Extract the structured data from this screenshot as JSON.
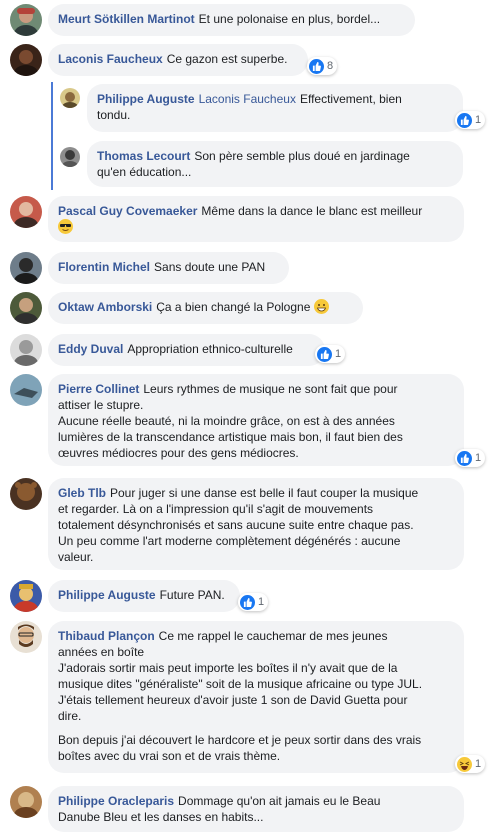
{
  "comments": [
    {
      "name": "Meurt Sötkillen Martinot",
      "text": "Et une polonaise en plus, bordel..."
    },
    {
      "name": "Laconis Faucheux",
      "text": "Ce gazon est superbe.",
      "reactions": "8"
    },
    {
      "name": "Philippe Auguste",
      "tag": "Laconis Faucheux",
      "text": "Effectivement, bien\ntondu.",
      "reactions": "1"
    },
    {
      "name": "Thomas Lecourt",
      "text": "Son père semble plus doué en jardinage\nqu'en éducation..."
    },
    {
      "name": "Pascal Guy Covemaeker",
      "text": "Même dans la dance le blanc est meilleur",
      "emoji": "sunglasses-emoji"
    },
    {
      "name": "Florentin Michel",
      "text": "Sans doute une PAN"
    },
    {
      "name": "Oktaw Amborski",
      "text": "Ça a bien changé la Pologne",
      "emoji": "grin-emoji"
    },
    {
      "name": "Eddy Duval",
      "text": "Appropriation ethnico-culturelle",
      "reactions": "1"
    },
    {
      "name": "Pierre Collinet",
      "text": "Leurs rythmes de musique ne sont fait que pour\nattiser le stupre.\nAucune réelle beauté, ni la moindre grâce, on est à des années\nlumières de la transcendance artistique mais bon, il faut bien des\nœuvres médiocres pour des gens médiocres.",
      "reactions": "1"
    },
    {
      "name": "Gleb Tlb",
      "text": "Pour juger si une danse est belle il faut couper la musique\net regarder. Là on a l'impression qu'il s'agit de mouvements\ntotalement désynchronisés et sans aucune suite entre chaque pas.\nUn peu comme l'art moderne complètement dégénérés : aucune\nvaleur."
    },
    {
      "name": "Philippe Auguste",
      "text": "Future PAN.",
      "reactions": "1"
    },
    {
      "name": "Thibaud Plançon",
      "text": "Ce me rappel le cauchemar de mes jeunes\nannées en boîte\nJ'adorais sortir mais peut importe les boîtes il n'y avait que de la\nmusique dites \"généraliste\" soit de la musique africaine ou type JUL.\nJ'étais tellement heureux d'avoir juste 1 son de David Guetta pour\ndire.",
      "text2": "Bon depuis j'ai découvert le hardcore et je peux sortir dans des vrais\nboîtes avec du vrai son et de vrais thème.",
      "reactions": "1"
    },
    {
      "name": "Philippe Oracleparis",
      "text": "Dommage qu'on ait jamais eu le Beau\nDanube Bleu et les danses en habits..."
    }
  ],
  "colors": {
    "name": "#385898",
    "bubble": "#f2f3f5",
    "like": "#1877f2",
    "thread_line": "#4b7ad6"
  }
}
